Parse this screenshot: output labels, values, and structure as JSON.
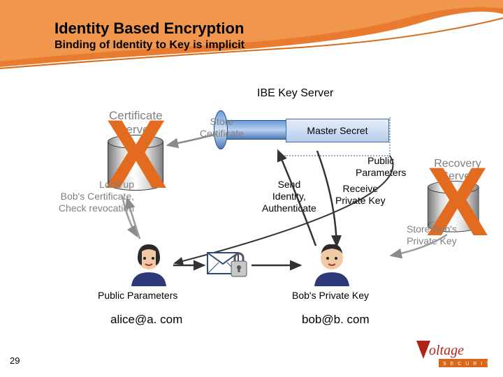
{
  "header": {
    "title": "Identity Based Encryption",
    "subtitle": "Binding of Identity to Key is implicit"
  },
  "labels": {
    "ibe_server": "IBE Key Server",
    "cert_server_l1": "Certificate",
    "cert_server_l2": "Server",
    "recovery_l1": "Recovery",
    "recovery_l2": "Server",
    "master_secret": "Master Secret",
    "store_cert_l1": "Store",
    "store_cert_l2": "Certificate",
    "public_params_l1": "Public",
    "public_params_l2": "Parameters",
    "send_id_l1": "Send",
    "send_id_l2": "Identity,",
    "send_id_l3": "Authenticate",
    "recv_key_l1": "Receive",
    "recv_key_l2": "Private Key",
    "lookup_l1": "Look up",
    "lookup_l2": "Bob's Certificate,",
    "lookup_l3": "Check revocation",
    "store_bob_l1": "Store Bob's",
    "store_bob_l2": "Private Key",
    "public_parameters_bottom": "Public Parameters",
    "bobs_private_key": "Bob's Private Key",
    "alice_email": "alice@a. com",
    "bob_email": "bob@b. com",
    "big_x": "X"
  },
  "page": {
    "number": "29"
  },
  "logo": {
    "brand_main": "Voltage",
    "brand_sub": "S E C U R I T Y"
  },
  "colors": {
    "brand_orange": "#e36b1f",
    "server_blue": "#6b9bd8"
  }
}
